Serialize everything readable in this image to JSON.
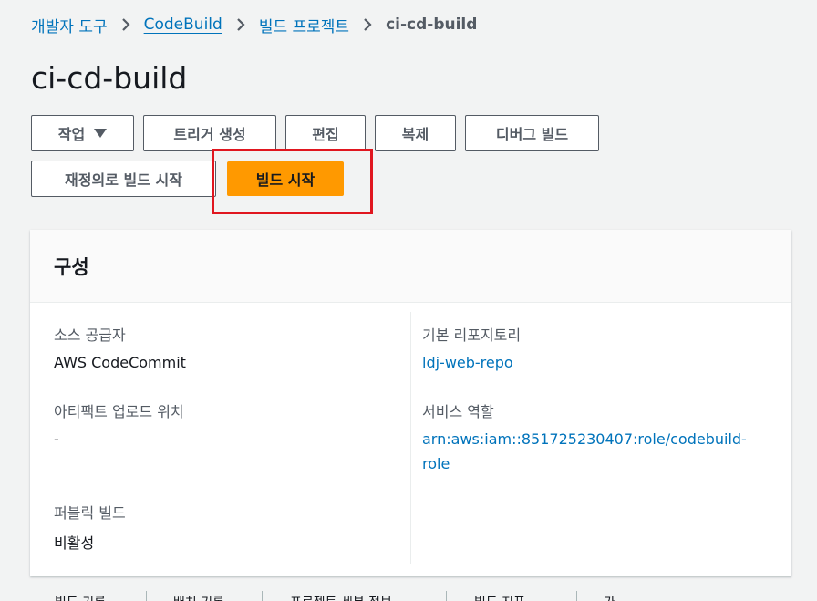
{
  "breadcrumb": {
    "items": [
      "개발자 도구",
      "CodeBuild",
      "빌드 프로젝트"
    ],
    "current": "ci-cd-build",
    "separator": "›"
  },
  "page": {
    "title": "ci-cd-build"
  },
  "actions": {
    "actions_label": "작업",
    "create_trigger": "트리거 생성",
    "edit": "편집",
    "clone": "복제",
    "debug_build": "디버그 빌드",
    "start_build_with_overrides": "재정의로 빌드 시작",
    "start_build": "빌드 시작"
  },
  "configuration": {
    "title": "구성",
    "source_provider_label": "소스 공급자",
    "source_provider_value": "AWS CodeCommit",
    "primary_repo_label": "기본 리포지토리",
    "primary_repo_value": "ldj-web-repo",
    "artifact_upload_label": "아티팩트 업로드 위치",
    "artifact_upload_value": "-",
    "service_role_label": "서비스 역할",
    "service_role_value_line1": "arn:aws:iam::851725230407:role/codebuild-",
    "service_role_value_line2": "role",
    "public_build_label": "퍼블릭 빌드",
    "public_build_value": "비활성"
  },
  "tabs": [
    "빌드 기록",
    "배치 기록",
    "프로젝트 세부 정보",
    "빌드 지표",
    "가"
  ],
  "colors": {
    "primary": "#ff9900",
    "link": "#0073bb",
    "highlight": "#e0161f"
  }
}
